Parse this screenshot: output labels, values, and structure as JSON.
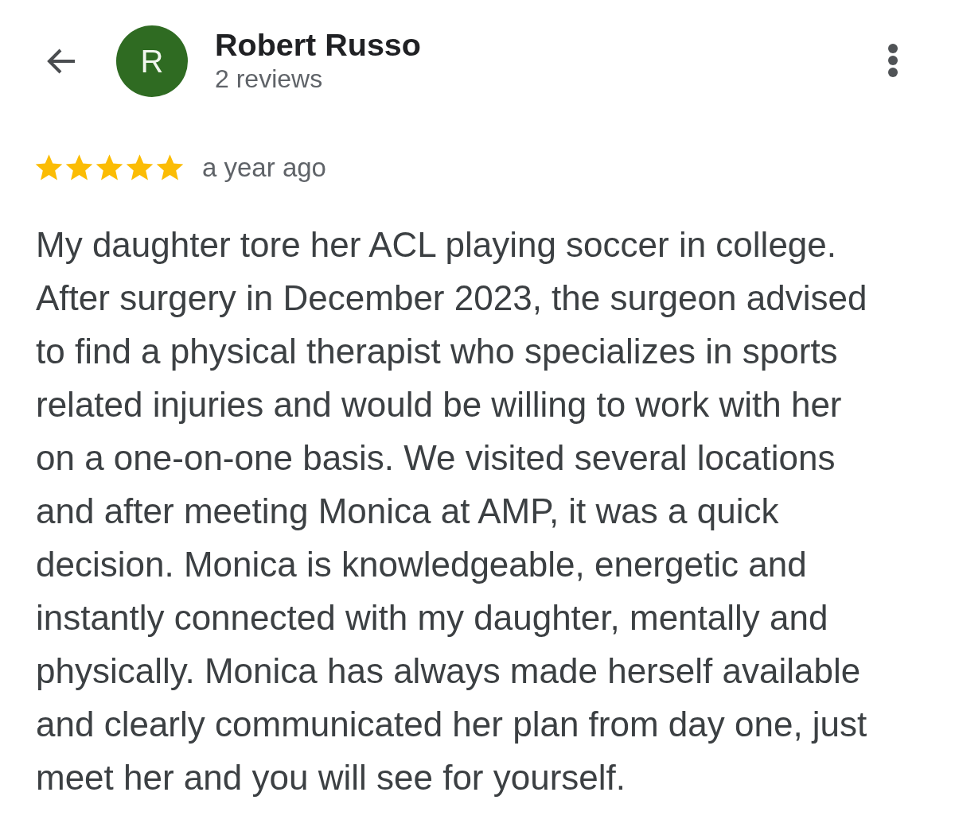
{
  "header": {
    "avatar_letter": "R",
    "name": "Robert Russo",
    "review_count": "2 reviews"
  },
  "review": {
    "stars": 5,
    "time": "a year ago",
    "text": "My daughter tore her ACL playing soccer in college. After surgery in December 2023, the surgeon advised to find a physical therapist who specializes in sports related injuries and would be willing to work with her on a one-on-one basis. We visited several locations and after meeting Monica at AMP, it was a quick decision. Monica is knowledgeable, energetic and instantly connected with my daughter, mentally and physically. Monica has always made herself available and clearly communicated her plan from day one, just meet her and you will see for yourself."
  }
}
